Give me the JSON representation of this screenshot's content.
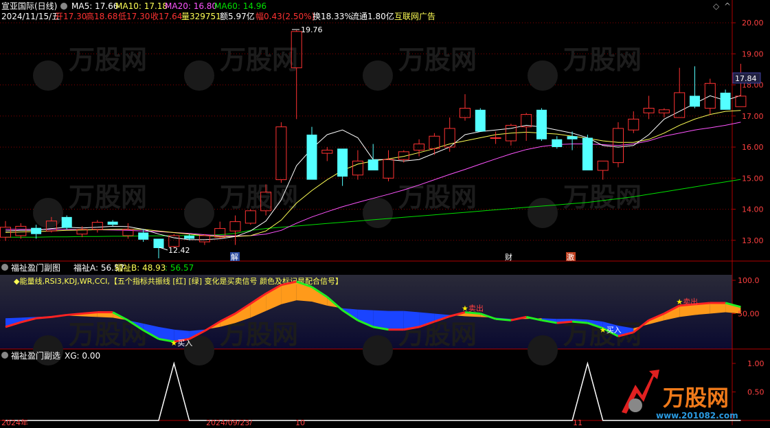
{
  "header": {
    "stock_title": "宣亚国际(日线)",
    "ma5": "MA5: 17.66",
    "ma10": "MA10: 17.18",
    "ma20": "MA20: 16.80",
    "ma60": "MA60: 14.96",
    "date": "2024/11/15/五",
    "open": "开17.30",
    "high": "高18.68",
    "low": "低17.30",
    "close": "收17.64",
    "volume": "量329751",
    "amount": "额5.97亿",
    "change": "幅0.43(2.50%)",
    "turnover": "换18.33%",
    "float_cap": "流通1.80亿",
    "concept": "互联网广告"
  },
  "colors": {
    "up": "#ff3232",
    "down": "#54ffff",
    "ma5": "#ffffff",
    "ma10": "#ffff55",
    "ma20": "#ff55ff",
    "ma60": "#00e000",
    "grid": "#8b0000",
    "axis_text": "#ff4040",
    "orange": "#ff9a1a",
    "blue": "#1a44ff",
    "green_line": "#22ee22",
    "red_line": "#ff2222"
  },
  "price_axis": {
    "ticks": [
      "20.00",
      "19.00",
      "18.00",
      "17.00",
      "16.00",
      "15.00",
      "14.00",
      "13.00"
    ],
    "current_price": "17.84"
  },
  "price_annotations": {
    "high_label": "19.76",
    "low_label": "12.42",
    "event_jie": "解",
    "event_cai": "财",
    "event_ji": "激"
  },
  "indicator1": {
    "name": "福祉盈门副图",
    "a_label": "福祉A: 56.57",
    "b_label": "福祉B: 48.93",
    "c_label": ": 56.57",
    "description": "◆能量线,RSI3,KDJ,WR,CCI,【五个指标共振线 [红] [绿] 变化是买卖信号 颜色及标记是配合信号】",
    "ticks": [
      "100.0",
      "50.00"
    ],
    "buy_label": "买入",
    "sell_label": "卖出"
  },
  "indicator2": {
    "name": "福祉盈门副选",
    "xg_label": "XG: 0.00",
    "ticks": [
      "1.00",
      "0.50"
    ]
  },
  "bottom_axis": {
    "labels": [
      "2024年",
      "2024/09/23/",
      "10",
      "11"
    ]
  },
  "watermark": {
    "brand": "万股网",
    "url": "www.201082.com"
  },
  "chart_data": {
    "type": "candlestick",
    "title": "宣亚国际(日线)",
    "ylim": [
      12.2,
      20.4
    ],
    "candles": [
      {
        "o": 13.1,
        "h": 13.62,
        "l": 12.98,
        "c": 13.42
      },
      {
        "o": 13.15,
        "h": 13.55,
        "l": 13.05,
        "c": 13.45
      },
      {
        "o": 13.4,
        "h": 13.5,
        "l": 13.05,
        "c": 13.2
      },
      {
        "o": 13.3,
        "h": 13.75,
        "l": 13.25,
        "c": 13.62
      },
      {
        "o": 13.75,
        "h": 13.8,
        "l": 13.35,
        "c": 13.4
      },
      {
        "o": 13.2,
        "h": 13.45,
        "l": 13.1,
        "c": 13.35
      },
      {
        "o": 13.35,
        "h": 13.65,
        "l": 13.25,
        "c": 13.58
      },
      {
        "o": 13.6,
        "h": 13.65,
        "l": 13.45,
        "c": 13.5
      },
      {
        "o": 13.15,
        "h": 13.55,
        "l": 13.05,
        "c": 13.35
      },
      {
        "o": 13.25,
        "h": 13.35,
        "l": 12.95,
        "c": 13.02
      },
      {
        "o": 13.05,
        "h": 13.05,
        "l": 12.42,
        "c": 12.75
      },
      {
        "o": 12.8,
        "h": 13.2,
        "l": 12.75,
        "c": 13.15
      },
      {
        "o": 13.15,
        "h": 13.2,
        "l": 13.0,
        "c": 13.05
      },
      {
        "o": 12.95,
        "h": 13.2,
        "l": 12.85,
        "c": 13.15
      },
      {
        "o": 13.1,
        "h": 13.6,
        "l": 13.05,
        "c": 13.38
      },
      {
        "o": 13.3,
        "h": 13.8,
        "l": 12.85,
        "c": 13.6
      },
      {
        "o": 13.55,
        "h": 14.0,
        "l": 13.5,
        "c": 13.95
      },
      {
        "o": 13.95,
        "h": 14.8,
        "l": 13.8,
        "c": 14.55
      },
      {
        "o": 14.95,
        "h": 16.8,
        "l": 14.85,
        "c": 16.65
      },
      {
        "o": 18.55,
        "h": 19.76,
        "l": 16.9,
        "c": 19.72
      },
      {
        "o": 16.4,
        "h": 16.65,
        "l": 14.95,
        "c": 14.95
      },
      {
        "o": 15.8,
        "h": 16.0,
        "l": 15.55,
        "c": 15.9
      },
      {
        "o": 15.95,
        "h": 15.95,
        "l": 14.75,
        "c": 15.05
      },
      {
        "o": 15.1,
        "h": 15.9,
        "l": 14.95,
        "c": 15.55
      },
      {
        "o": 15.6,
        "h": 16.1,
        "l": 15.25,
        "c": 15.25
      },
      {
        "o": 15.0,
        "h": 15.9,
        "l": 14.9,
        "c": 15.6
      },
      {
        "o": 15.6,
        "h": 15.9,
        "l": 15.5,
        "c": 15.85
      },
      {
        "o": 15.9,
        "h": 16.25,
        "l": 15.7,
        "c": 16.1
      },
      {
        "o": 15.95,
        "h": 16.45,
        "l": 15.75,
        "c": 16.35
      },
      {
        "o": 16.0,
        "h": 16.95,
        "l": 15.85,
        "c": 16.6
      },
      {
        "o": 16.95,
        "h": 17.7,
        "l": 16.85,
        "c": 17.25
      },
      {
        "o": 17.2,
        "h": 17.25,
        "l": 16.5,
        "c": 16.5
      },
      {
        "o": 16.3,
        "h": 16.5,
        "l": 16.1,
        "c": 16.3
      },
      {
        "o": 16.2,
        "h": 16.75,
        "l": 16.05,
        "c": 16.7
      },
      {
        "o": 16.65,
        "h": 17.1,
        "l": 16.2,
        "c": 17.05
      },
      {
        "o": 17.2,
        "h": 17.25,
        "l": 16.2,
        "c": 16.25
      },
      {
        "o": 16.25,
        "h": 16.35,
        "l": 15.95,
        "c": 16.0
      },
      {
        "o": 16.35,
        "h": 16.5,
        "l": 15.9,
        "c": 16.25
      },
      {
        "o": 16.3,
        "h": 16.4,
        "l": 15.25,
        "c": 15.25
      },
      {
        "o": 15.25,
        "h": 15.55,
        "l": 14.95,
        "c": 15.55
      },
      {
        "o": 15.5,
        "h": 16.8,
        "l": 15.35,
        "c": 16.6
      },
      {
        "o": 16.55,
        "h": 17.15,
        "l": 16.45,
        "c": 16.9
      },
      {
        "o": 17.1,
        "h": 17.65,
        "l": 16.9,
        "c": 17.25
      },
      {
        "o": 17.1,
        "h": 17.25,
        "l": 16.95,
        "c": 17.2
      },
      {
        "o": 16.95,
        "h": 18.55,
        "l": 16.95,
        "c": 17.75
      },
      {
        "o": 17.65,
        "h": 18.6,
        "l": 17.25,
        "c": 17.3
      },
      {
        "o": 17.25,
        "h": 18.2,
        "l": 17.05,
        "c": 18.05
      },
      {
        "o": 17.75,
        "h": 17.85,
        "l": 17.2,
        "c": 17.2
      },
      {
        "o": 17.3,
        "h": 18.68,
        "l": 17.3,
        "c": 17.64
      }
    ],
    "ma5": [
      13.3,
      13.32,
      13.32,
      13.38,
      13.42,
      13.4,
      13.42,
      13.45,
      13.44,
      13.35,
      13.2,
      13.08,
      13.02,
      13.02,
      13.05,
      13.12,
      13.3,
      13.62,
      14.3,
      15.4,
      15.95,
      16.4,
      16.55,
      16.3,
      15.6,
      15.6,
      15.55,
      15.6,
      15.8,
      16.0,
      16.4,
      16.5,
      16.55,
      16.6,
      16.7,
      16.65,
      16.55,
      16.45,
      16.3,
      16.05,
      16.0,
      16.05,
      16.4,
      16.9,
      17.15,
      17.4,
      17.65,
      17.5,
      17.66
    ],
    "ma10": [
      13.25,
      13.27,
      13.28,
      13.3,
      13.32,
      13.33,
      13.34,
      13.35,
      13.36,
      13.35,
      13.3,
      13.25,
      13.2,
      13.15,
      13.12,
      13.12,
      13.15,
      13.3,
      13.65,
      14.2,
      14.6,
      14.95,
      15.25,
      15.45,
      15.55,
      15.62,
      15.7,
      15.82,
      15.95,
      16.1,
      16.2,
      16.3,
      16.4,
      16.45,
      16.48,
      16.45,
      16.42,
      16.35,
      16.28,
      16.2,
      16.15,
      16.15,
      16.25,
      16.45,
      16.7,
      16.9,
      17.05,
      17.15,
      17.18
    ],
    "ma20": [
      13.35,
      13.35,
      13.35,
      13.35,
      13.35,
      13.34,
      13.34,
      13.33,
      13.32,
      13.3,
      13.28,
      13.25,
      13.22,
      13.18,
      13.15,
      13.14,
      13.15,
      13.2,
      13.32,
      13.55,
      13.75,
      13.92,
      14.08,
      14.22,
      14.35,
      14.48,
      14.62,
      14.78,
      14.95,
      15.12,
      15.28,
      15.45,
      15.62,
      15.78,
      15.92,
      16.02,
      16.08,
      16.1,
      16.1,
      16.08,
      16.05,
      16.1,
      16.2,
      16.35,
      16.45,
      16.55,
      16.62,
      16.7,
      16.8
    ],
    "ma60": [
      13.1,
      13.1,
      13.1,
      13.11,
      13.11,
      13.12,
      13.12,
      13.13,
      13.13,
      13.14,
      13.14,
      13.15,
      13.15,
      13.16,
      13.18,
      13.22,
      13.32,
      13.38,
      13.42,
      13.46,
      13.5,
      13.54,
      13.58,
      13.62,
      13.66,
      13.7,
      13.74,
      13.78,
      13.82,
      13.86,
      13.9,
      13.94,
      13.98,
      14.02,
      14.06,
      14.1,
      14.14,
      14.18,
      14.22,
      14.28,
      14.34,
      14.4,
      14.48,
      14.56,
      14.64,
      14.72,
      14.8,
      14.88,
      14.96
    ],
    "indicator1_a": [
      30,
      37,
      43,
      45,
      48,
      50,
      52,
      52,
      40,
      25,
      12,
      8,
      12,
      24,
      38,
      50,
      65,
      80,
      93,
      98,
      90,
      75,
      55,
      40,
      30,
      26,
      26,
      30,
      38,
      46,
      52,
      50,
      42,
      40,
      45,
      40,
      36,
      38,
      36,
      28,
      16,
      22,
      40,
      50,
      62,
      64,
      66,
      66,
      60
    ],
    "indicator1_b": [
      43,
      44,
      45,
      46,
      47,
      46,
      45,
      44,
      40,
      35,
      30,
      26,
      24,
      26,
      30,
      36,
      44,
      54,
      64,
      70,
      68,
      62,
      58,
      56,
      55,
      54,
      54,
      52,
      50,
      48,
      46,
      45,
      44,
      42,
      42,
      43,
      42,
      42,
      41,
      38,
      32,
      28,
      34,
      40,
      45,
      48,
      50,
      52,
      50
    ],
    "indicator2_xg": [
      0,
      0,
      0,
      0,
      0,
      0,
      0,
      0,
      0,
      0,
      0,
      1,
      0,
      0,
      0,
      0,
      0,
      0,
      0,
      0,
      0,
      0,
      0,
      0,
      0,
      0,
      0,
      0,
      0,
      0,
      0,
      0,
      0,
      0,
      0,
      0,
      0,
      0,
      1,
      0,
      0,
      0,
      0,
      0,
      0,
      0,
      0,
      0,
      0
    ]
  }
}
